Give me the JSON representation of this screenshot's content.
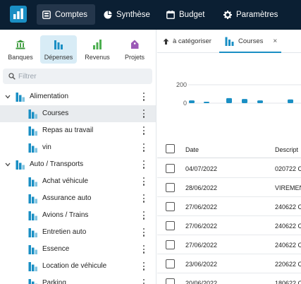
{
  "colors": {
    "topbar": "#0b1f33",
    "accent": "#1a8fc4",
    "bar_light": "#7fc3e0"
  },
  "topnav": {
    "items": [
      {
        "label": "Comptes",
        "icon": "accounts-icon",
        "active": true
      },
      {
        "label": "Synthèse",
        "icon": "pie-chart-icon",
        "active": false
      },
      {
        "label": "Budget",
        "icon": "calendar-icon",
        "active": false
      },
      {
        "label": "Paramètres",
        "icon": "gear-icon",
        "active": false
      }
    ]
  },
  "sidebar": {
    "tabs": [
      {
        "label": "Banques",
        "icon": "bank-icon"
      },
      {
        "label": "Dépenses",
        "icon": "expenses-icon"
      },
      {
        "label": "Revenus",
        "icon": "income-icon"
      },
      {
        "label": "Projets",
        "icon": "tag-icon"
      }
    ],
    "filter_placeholder": "Filtrer",
    "tree": [
      {
        "label": "Alimentation",
        "level": 0,
        "expanded": true,
        "selected": false
      },
      {
        "label": "Courses",
        "level": 1,
        "selected": true
      },
      {
        "label": "Repas au travail",
        "level": 1,
        "selected": false
      },
      {
        "label": "vin",
        "level": 1,
        "selected": false
      },
      {
        "label": "Auto / Transports",
        "level": 0,
        "expanded": true,
        "selected": false
      },
      {
        "label": "Achat véhicule",
        "level": 1,
        "selected": false
      },
      {
        "label": "Assurance auto",
        "level": 1,
        "selected": false
      },
      {
        "label": "Avions / Trains",
        "level": 1,
        "selected": false
      },
      {
        "label": "Entretien auto",
        "level": 1,
        "selected": false
      },
      {
        "label": "Essence",
        "level": 1,
        "selected": false
      },
      {
        "label": "Location de véhicule",
        "level": 1,
        "selected": false
      },
      {
        "label": "Parking",
        "level": 1,
        "selected": false
      }
    ]
  },
  "tabs": {
    "acategoriser": "à catégoriser",
    "courses": "Courses",
    "close": "×"
  },
  "chart_data": {
    "type": "bar",
    "y_ticks": [
      "200",
      "0"
    ],
    "ylim": [
      0,
      200
    ],
    "values": [
      30,
      15,
      55,
      45,
      30,
      0,
      40
    ],
    "grid": true
  },
  "table": {
    "headers": [
      "Date",
      "Descript"
    ],
    "rows": [
      {
        "date": "04/07/2022",
        "description": "020722 C"
      },
      {
        "date": "28/06/2022",
        "description": "VIREMEN"
      },
      {
        "date": "27/06/2022",
        "description": "240622 C"
      },
      {
        "date": "27/06/2022",
        "description": "240622 C"
      },
      {
        "date": "27/06/2022",
        "description": "240622 C"
      },
      {
        "date": "23/06/2022",
        "description": "220622 C"
      },
      {
        "date": "20/06/2022",
        "description": "180622 C"
      }
    ]
  }
}
